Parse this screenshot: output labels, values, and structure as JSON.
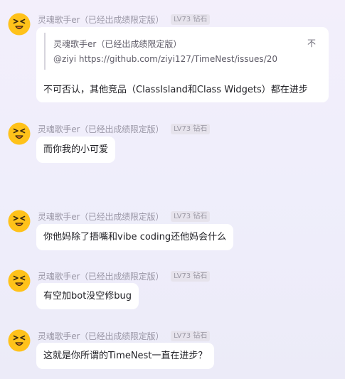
{
  "messages": [
    {
      "sender": "灵魂歌手er（已经出成绩限定版）",
      "badge": "LV73 钻石",
      "quote": {
        "name": "灵魂歌手er（已经出成绩限定版）",
        "link_text": "@ziyi https://github.com/ziyi127/TimeNest/issues/20",
        "more": "不"
      },
      "text": "不可否认，其他竞品（ClassIsland和Class Widgets）都在进步"
    },
    {
      "sender": "灵魂歌手er（已经出成绩限定版）",
      "badge": "LV73 钻石",
      "text": "而你我的小可爱"
    },
    {
      "sender": "灵魂歌手er（已经出成绩限定版）",
      "badge": "LV73 钻石",
      "text": "你他妈除了捂嘴和vibe coding还他妈会什么"
    },
    {
      "sender": "灵魂歌手er（已经出成绩限定版）",
      "badge": "LV73 钻石",
      "text": "有空加bot没空修bug"
    },
    {
      "sender": "灵魂歌手er（已经出成绩限定版）",
      "badge": "LV73 钻石",
      "text": "这就是你所谓的TimeNest一直在进步？"
    }
  ],
  "avatar_icon": "squinting-emoji-face-icon",
  "colors": {
    "avatar_face": "#ffc21a",
    "avatar_mouth": "#f07c1e",
    "avatar_features": "#3a2a10",
    "bubble": "#ffffff",
    "badge_bg": "#e6e3ec"
  }
}
